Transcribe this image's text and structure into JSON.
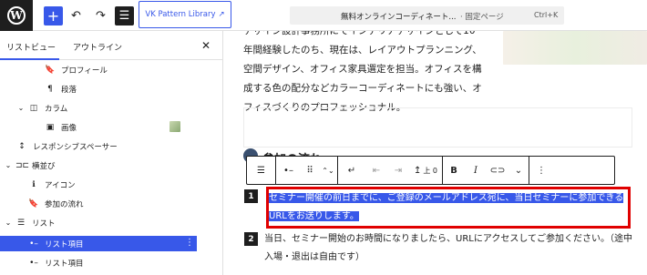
{
  "topbar": {
    "logo": "W",
    "add": "+",
    "undo": "↶",
    "redo": "↷",
    "list_view": "☰",
    "pattern_label": "VK Pattern Library",
    "pattern_ext_icon": "↗",
    "command_title": "無料オンラインコーディネート...",
    "command_type": "· 固定ページ",
    "command_shortcut": "Ctrl+K"
  },
  "sidebar": {
    "tab_list": "リストビュー",
    "tab_outline": "アウトライン",
    "close": "✕",
    "items": [
      {
        "label": "プロフィール",
        "icon": "bookmark-icon",
        "glyph": "🔖"
      },
      {
        "label": "段落",
        "icon": "paragraph-icon",
        "glyph": "¶"
      },
      {
        "label": "カラム",
        "icon": "columns-icon",
        "glyph": "◫"
      },
      {
        "label": "画像",
        "icon": "image-icon",
        "glyph": "▣"
      },
      {
        "label": "レスポンシブスペーサー",
        "icon": "spacer-icon",
        "glyph": "↕"
      },
      {
        "label": "横並び",
        "icon": "row-icon",
        "glyph": "⊐⊏"
      },
      {
        "label": "アイコン",
        "icon": "info-icon",
        "glyph": "ℹ"
      },
      {
        "label": "参加の流れ",
        "icon": "bookmark-icon",
        "glyph": "🔖"
      },
      {
        "label": "リスト",
        "icon": "list-icon",
        "glyph": "☰"
      },
      {
        "label": "リスト項目",
        "icon": "list-item-icon",
        "glyph": "•–"
      },
      {
        "label": "リスト項目",
        "icon": "list-item-icon",
        "glyph": "•–"
      }
    ],
    "selected_kebab": "⋮"
  },
  "canvas": {
    "bio_lines": [
      "デザイン設計事務所にてインテリアデザインとして10",
      "年間経験したのち、現在は、レイアウトプランニング、",
      "空間デザイン、オフィス家具選定を担当。オフィスを構",
      "成する色の配分などカラーコーディネートにも強い、オ",
      "フィスづくりのプロフェッショナル。"
    ],
    "heading": "参加の流れ",
    "toolbar": {
      "block_type": "☰",
      "list_item": "•–",
      "drag": "⠿",
      "move": "⌃⌄",
      "outdent": "↵",
      "indent_left": "⇤",
      "indent_right": "⇥",
      "lineheight_value": "上 0",
      "bold": "B",
      "italic": "I",
      "link": "⊂⊃",
      "more": "⌄",
      "options": "⋮"
    },
    "list": [
      {
        "number": "1",
        "text": "セミナー開催の前日までに、ご登録のメールアドレス宛に、当日セミナーに参加できるURLをお送りします。"
      },
      {
        "number": "2",
        "text": "当日、セミナー開始のお時間になりましたら、URLにアクセスしてご参加ください。（途中入場・退出は自由です）"
      }
    ]
  }
}
